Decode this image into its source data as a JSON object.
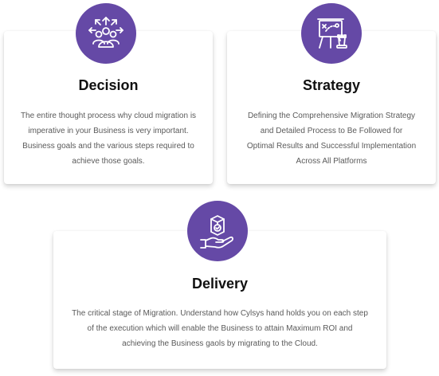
{
  "cards": [
    {
      "title": "Decision",
      "icon": "decision-arrows-people-icon",
      "text": "The entire thought process why cloud migration is imperative in your Business is very important. Business goals and the various steps required to achieve those goals."
    },
    {
      "title": "Strategy",
      "icon": "strategy-board-chess-icon",
      "text": "Defining the Comprehensive Migration Strategy and Detailed Process to Be Followed for Optimal Results and Successful Implementation Across All Platforms"
    },
    {
      "title": "Delivery",
      "icon": "delivery-hand-box-icon",
      "text": "The critical stage of Migration. Understand how Cylsys hand holds you on each step of the execution which will enable the Business to attain Maximum ROI and achieving the Business gaols by migrating to the Cloud."
    }
  ],
  "colors": {
    "accent": "#6549a6",
    "title": "#111111",
    "body_text": "#5a5a5a",
    "background": "#ffffff"
  }
}
